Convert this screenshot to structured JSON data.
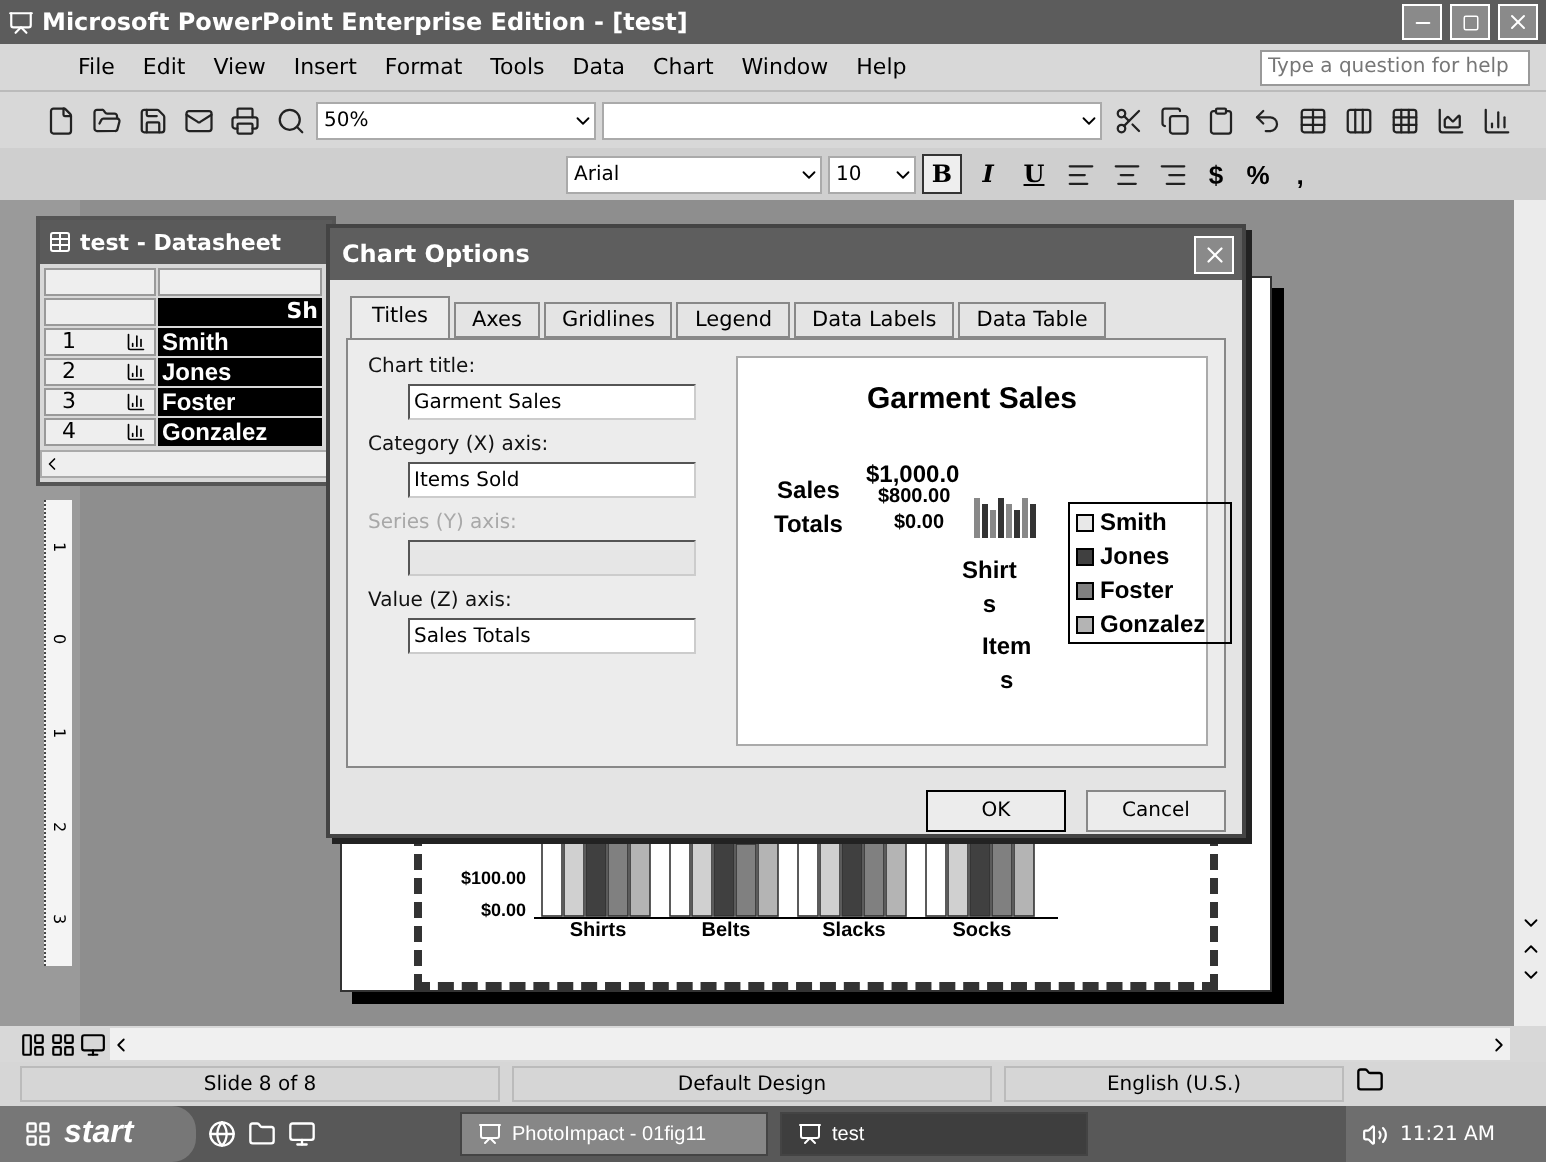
{
  "window": {
    "title": "Microsoft PowerPoint Enterprise Edition - [test]"
  },
  "menu": [
    "File",
    "Edit",
    "View",
    "Insert",
    "Format",
    "Tools",
    "Data",
    "Chart",
    "Window",
    "Help"
  ],
  "help_search": {
    "placeholder": "Type a question for help"
  },
  "standard_toolbar": {
    "zoom": "50%"
  },
  "format_toolbar": {
    "font": "Arial",
    "size": "10",
    "style_buttons": [
      {
        "label": "B",
        "pressed": true
      },
      {
        "label": "I",
        "pressed": false
      },
      {
        "label": "U",
        "pressed": false
      }
    ],
    "number_buttons": [
      "$",
      "%",
      ","
    ]
  },
  "datasheet": {
    "title": "test - Datasheet",
    "column_header": "Sh",
    "rows": [
      {
        "number": "1",
        "name": "Smith"
      },
      {
        "number": "2",
        "name": "Jones"
      },
      {
        "number": "3",
        "name": "Foster"
      },
      {
        "number": "4",
        "name": "Gonzalez"
      }
    ]
  },
  "dialog": {
    "title": "Chart Options",
    "tabs": [
      {
        "label": "Titles",
        "selected": true
      },
      {
        "label": "Axes",
        "selected": false
      },
      {
        "label": "Gridlines",
        "selected": false
      },
      {
        "label": "Legend",
        "selected": false
      },
      {
        "label": "Data Labels",
        "selected": false
      },
      {
        "label": "Data Table",
        "selected": false
      }
    ],
    "fields": [
      {
        "label": "Chart title:",
        "value": "Garment Sales",
        "disabled": false
      },
      {
        "label": "Category (X) axis:",
        "value": "Items Sold",
        "disabled": false
      },
      {
        "label": "Series (Y) axis:",
        "disabled": true
      },
      {
        "label": "Value (Z) axis:",
        "value": "Sales Totals",
        "disabled": false
      }
    ],
    "preview": {
      "title": "Garment Sales",
      "value_axis_title": [
        "Sales",
        "Totals"
      ],
      "top_tick": "$1,000.0",
      "tick_clutter": [
        "$800.00",
        "$0.00"
      ],
      "category_label": [
        "Shirt",
        "s"
      ],
      "category_axis_title": [
        "Item",
        "s"
      ],
      "legend": [
        {
          "name": "Smith",
          "color": "#e8e8e8"
        },
        {
          "name": "Jones",
          "color": "#404040"
        },
        {
          "name": "Foster",
          "color": "#808080"
        },
        {
          "name": "Gonzalez",
          "color": "#b4b4b4"
        }
      ]
    },
    "buttons": [
      "OK",
      "Cancel"
    ]
  },
  "slide_chart": {
    "y_labels": [
      "$100.00",
      "$0.00"
    ],
    "categories": [
      "Shirts",
      "Belts",
      "Slacks",
      "Socks"
    ]
  },
  "ruler_labels": [
    "1",
    "0",
    "1",
    "2",
    "3"
  ],
  "status_bar": [
    "Slide 8 of 8",
    "Default Design",
    "English (U.S.)"
  ],
  "taskbar": {
    "start": "start",
    "tasks": [
      {
        "label": "PhotoImpact - 01fig11",
        "selected": false
      },
      {
        "label": "test",
        "selected": true
      }
    ],
    "clock": "11:21 AM"
  }
}
